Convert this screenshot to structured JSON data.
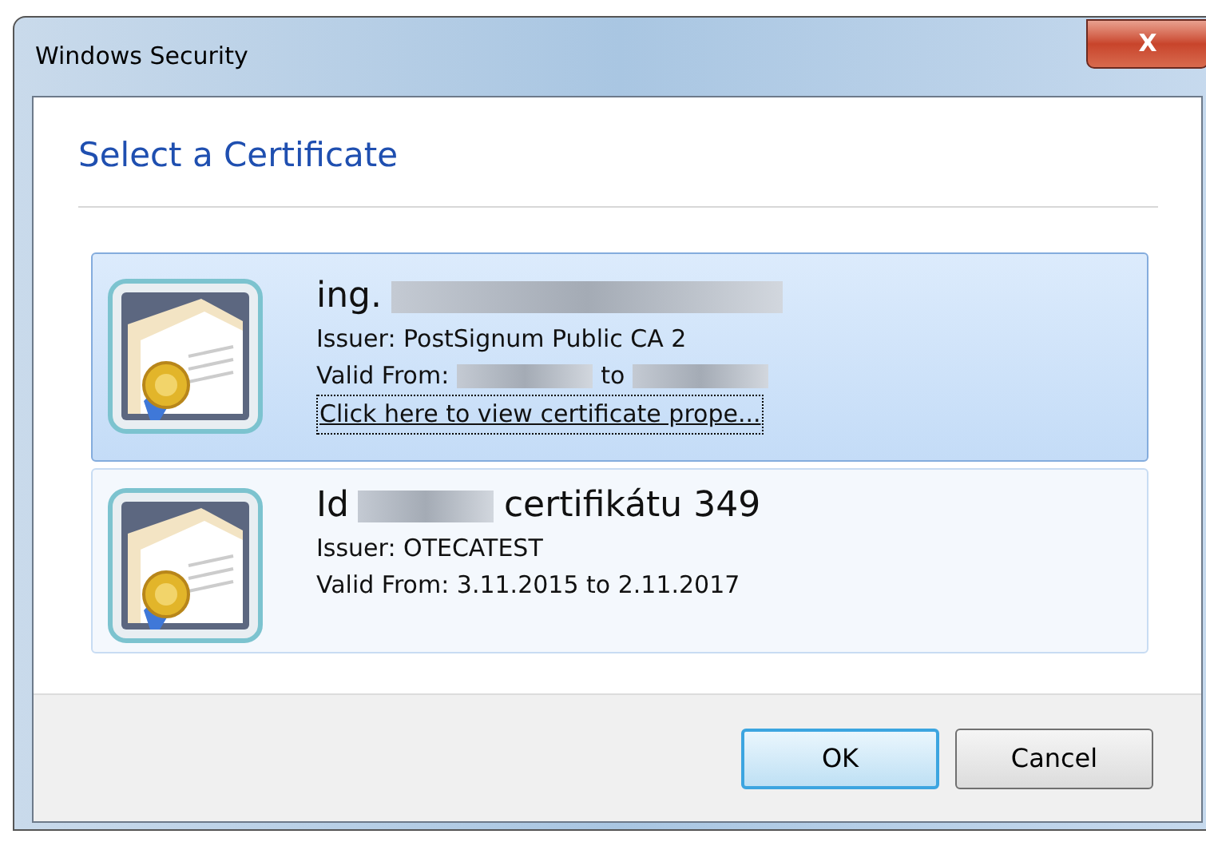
{
  "window": {
    "title": "Windows Security",
    "close": "X"
  },
  "heading": "Select a Certificate",
  "certificates": [
    {
      "selected": true,
      "title": [
        {
          "kind": "text",
          "text": "ing."
        },
        {
          "kind": "redacted_long"
        }
      ],
      "issuer": "Issuer: PostSignum Public CA 2",
      "valid": [
        {
          "kind": "text",
          "text": "Valid From:"
        },
        {
          "kind": "redacted"
        },
        {
          "kind": "text",
          "text": "to"
        },
        {
          "kind": "redacted"
        }
      ],
      "link": {
        "text": "Click here to view certificate prope...",
        "focused": true
      }
    },
    {
      "selected": false,
      "title": [
        {
          "kind": "text",
          "text": "Id"
        },
        {
          "kind": "redacted"
        },
        {
          "kind": "text",
          "text": "certifikátu 349"
        }
      ],
      "issuer": "Issuer: OTECATEST",
      "valid": [
        {
          "kind": "text",
          "text": "Valid From: 3.11.2015 to 2.11.2017"
        }
      ]
    }
  ],
  "buttons": [
    {
      "label": "OK",
      "default": true
    },
    {
      "label": "Cancel",
      "default": false
    }
  ]
}
